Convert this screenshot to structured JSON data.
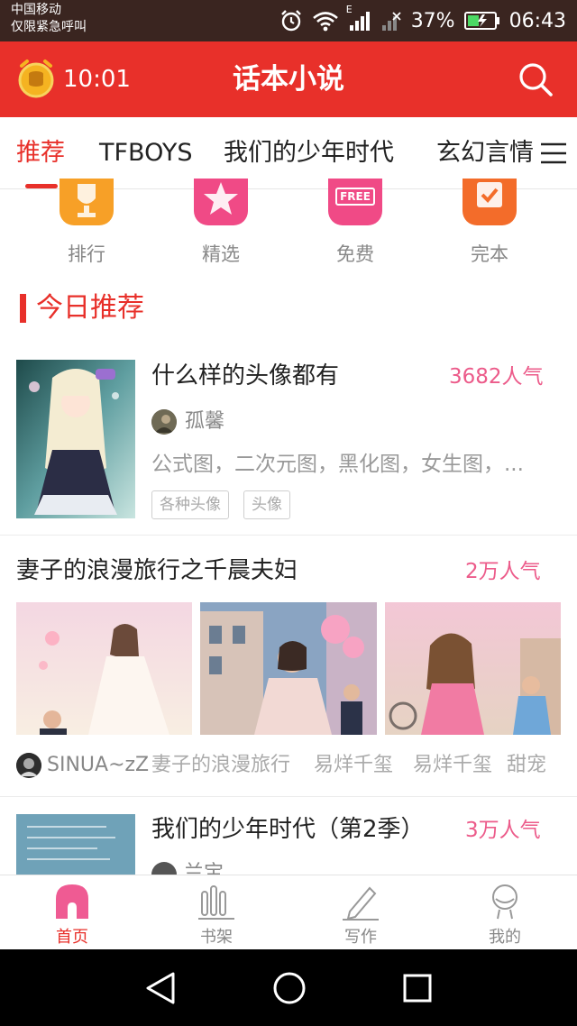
{
  "status_bar": {
    "carrier_line1": "中国移动",
    "carrier_line2": "仅限紧急呼叫",
    "battery": "37%",
    "time": "06:43",
    "network": "E"
  },
  "app_bar": {
    "timer": "10:01",
    "title": "话本小说"
  },
  "tabs": [
    "推荐",
    "TFBOYS",
    "我们的少年时代",
    "玄幻言情"
  ],
  "categories": [
    {
      "label": "排行",
      "icon": "trophy-icon",
      "color": "#f7a027"
    },
    {
      "label": "精选",
      "icon": "star-icon",
      "color": "#f04a86"
    },
    {
      "label": "免费",
      "icon": "free-icon",
      "color": "#f04a86",
      "icon_text": "FREE"
    },
    {
      "label": "完本",
      "icon": "check-icon",
      "color": "#f36c2a"
    }
  ],
  "section": {
    "title": "今日推荐"
  },
  "card1": {
    "title": "什么样的头像都有",
    "popularity": "3682人气",
    "author": "孤馨",
    "description": "公式图，二次元图，黑化图，女生图，...",
    "tags": [
      "各种头像",
      "头像"
    ]
  },
  "card2": {
    "title": "妻子的浪漫旅行之千晨夫妇",
    "popularity": "2万人气",
    "author": "SINUA~zZ",
    "meta": [
      "妻子的浪漫旅行",
      "易烊千玺",
      "易烊千玺",
      "甜宠"
    ]
  },
  "card3": {
    "title": "我们的少年时代（第2季）",
    "popularity": "3万人气",
    "author_partial": "兰宝"
  },
  "bottom_nav": [
    {
      "label": "首页",
      "icon": "home-icon"
    },
    {
      "label": "书架",
      "icon": "bookshelf-icon"
    },
    {
      "label": "写作",
      "icon": "pencil-icon"
    },
    {
      "label": "我的",
      "icon": "profile-icon"
    }
  ],
  "colors": {
    "brand_red": "#e8302a",
    "popularity_pink": "#ec5b8a",
    "status_bar_bg": "#3a2520"
  }
}
